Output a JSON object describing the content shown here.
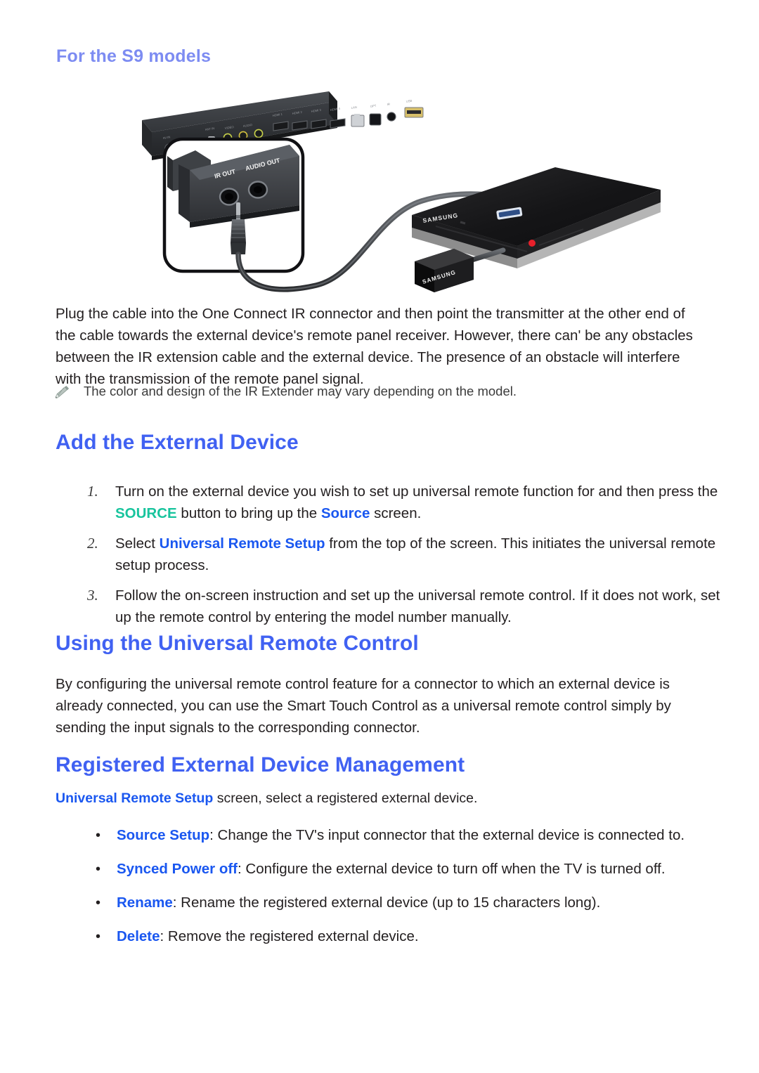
{
  "page": {
    "subheading": "For the S9 models",
    "paragraph_plug": "Plug the cable into the One Connect IR connector and then point the transmitter at the other end of the cable towards the external device's remote panel receiver. However, there can' be any obstacles between the IR extension cable and the external device. The presence of an obstacle will interfere with the transmission of the remote panel signal.",
    "note": {
      "icon": "pencil-icon",
      "text": "The color and design of the IR Extender may vary depending on the model."
    }
  },
  "illustration": {
    "name": "one-connect-ir-extender-diagram",
    "labels": {
      "ir_out": "IR OUT",
      "audio_out": "AUDIO OUT",
      "brand_player": "SAMSUNG",
      "brand_extender": "SAMSUNG"
    }
  },
  "section_add_external": {
    "heading": "Add the External Device",
    "steps": [
      {
        "number": "1.",
        "parts": [
          {
            "text": "Turn on the external device you wish to set up universal remote function for and then press the ",
            "style": "plain"
          },
          {
            "text": "SOURCE",
            "style": "teal"
          },
          {
            "text": " button to bring up the ",
            "style": "plain"
          },
          {
            "text": "Source",
            "style": "blue"
          },
          {
            "text": " screen.",
            "style": "plain"
          }
        ]
      },
      {
        "number": "2.",
        "parts": [
          {
            "text": "Select ",
            "style": "plain"
          },
          {
            "text": "Universal Remote Setup",
            "style": "blue"
          },
          {
            "text": " from the top of the screen. This initiates the universal remote setup process.",
            "style": "plain"
          }
        ]
      },
      {
        "number": "3.",
        "parts": [
          {
            "text": "Follow the on-screen instruction and set up the universal remote control. If it does not work, set up the remote control by entering the model number manually.",
            "style": "plain"
          }
        ]
      }
    ]
  },
  "section_using_urc": {
    "heading": "Using the Universal Remote Control",
    "paragraph": "By configuring the universal remote control feature for a connector to which an external device is already connected, you can use the Smart Touch Control as a universal remote control simply by sending the input signals to the corresponding connector."
  },
  "section_registered": {
    "heading": "Registered External Device Management",
    "intro_parts": [
      {
        "text": "Universal Remote Setup",
        "style": "blue"
      },
      {
        "text": " screen, select a registered external device.",
        "style": "plain"
      }
    ],
    "bullets": [
      {
        "marker": "•",
        "parts": [
          {
            "text": "Source Setup",
            "style": "blue"
          },
          {
            "text": ": Change the TV's input connector that the external device is connected to.",
            "style": "plain"
          }
        ]
      },
      {
        "marker": "•",
        "parts": [
          {
            "text": "Synced Power off",
            "style": "blue"
          },
          {
            "text": ": Configure the external device to turn off when the TV is turned off.",
            "style": "plain"
          }
        ]
      },
      {
        "marker": "•",
        "parts": [
          {
            "text": "Rename",
            "style": "blue"
          },
          {
            "text": ": Rename the registered external device (up to 15 characters long).",
            "style": "plain"
          }
        ]
      },
      {
        "marker": "•",
        "parts": [
          {
            "text": "Delete",
            "style": "blue"
          },
          {
            "text": ": Remove the registered external device.",
            "style": "plain"
          }
        ]
      }
    ]
  },
  "colors": {
    "heading_blue": "#4061f2",
    "subheading_blue": "#7d8cf2",
    "link_blue": "#1a57f0",
    "accent_teal": "#18c49d",
    "body_text": "#231f20",
    "note_text": "#3b3b3b",
    "pencil_icon": "#8a9a92"
  }
}
